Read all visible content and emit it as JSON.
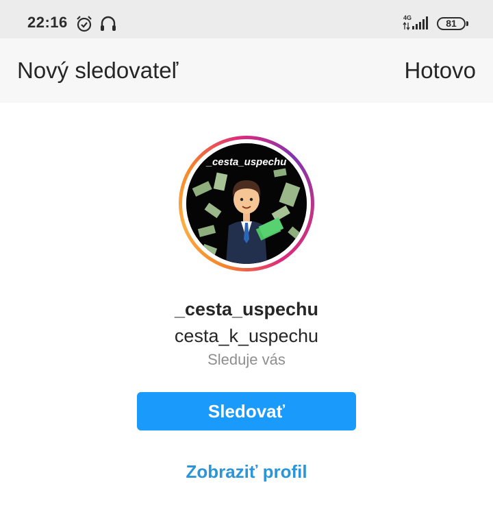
{
  "status_bar": {
    "time": "22:16",
    "network": "4G",
    "battery": "81",
    "icons": [
      "alarm-icon",
      "headset-icon",
      "signal-icon",
      "battery-icon"
    ]
  },
  "header": {
    "title": "Nový sledovateľ",
    "done_label": "Hotovo"
  },
  "profile": {
    "avatar_text": "_cesta_uspechu",
    "username": "_cesta_uspechu",
    "full_name": "cesta_k_uspechu",
    "follows_you": "Sleduje vás"
  },
  "actions": {
    "follow_label": "Sledovať",
    "view_profile_label": "Zobraziť profil"
  },
  "colors": {
    "follow_button": "#1a9bfb",
    "link": "#2a95d8",
    "header_bg": "#f7f7f7",
    "status_bg": "#ececec"
  }
}
